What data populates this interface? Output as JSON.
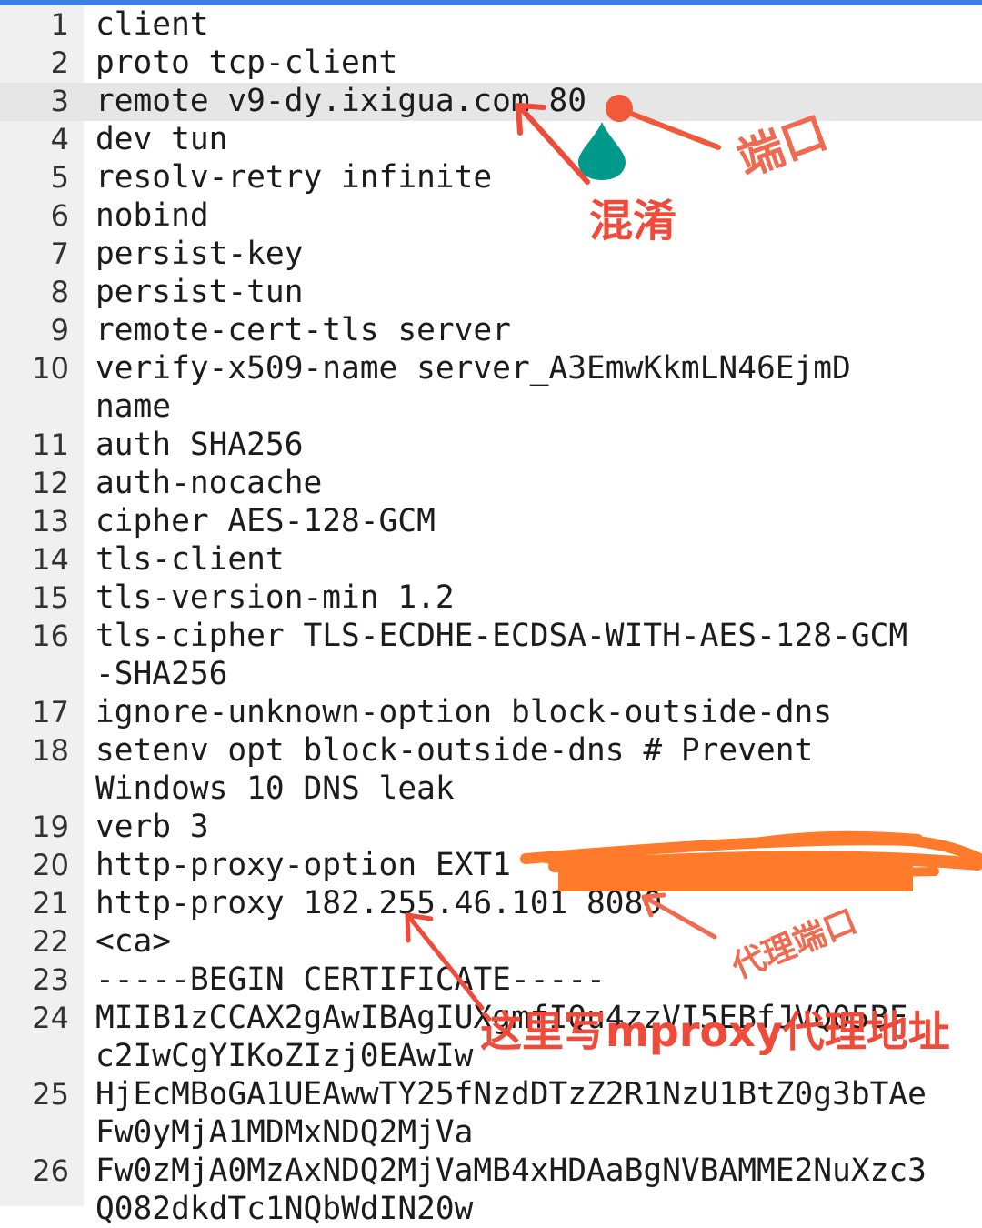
{
  "editor": {
    "highlighted_line": 3,
    "lines": [
      {
        "num": "1",
        "text": "client"
      },
      {
        "num": "2",
        "text": "proto tcp-client"
      },
      {
        "num": "3",
        "text": "remote v9-dy.ixigua.com 80"
      },
      {
        "num": "4",
        "text": "dev tun"
      },
      {
        "num": "5",
        "text": "resolv-retry infinite"
      },
      {
        "num": "6",
        "text": "nobind"
      },
      {
        "num": "7",
        "text": "persist-key"
      },
      {
        "num": "8",
        "text": "persist-tun"
      },
      {
        "num": "9",
        "text": "remote-cert-tls server"
      },
      {
        "num": "10",
        "text": "verify-x509-name server_A3EmwKkmLN46EjmD"
      },
      {
        "num": "",
        "text": "name"
      },
      {
        "num": "11",
        "text": "auth SHA256"
      },
      {
        "num": "12",
        "text": "auth-nocache"
      },
      {
        "num": "13",
        "text": "cipher AES-128-GCM"
      },
      {
        "num": "14",
        "text": "tls-client"
      },
      {
        "num": "15",
        "text": "tls-version-min 1.2"
      },
      {
        "num": "16",
        "text": "tls-cipher TLS-ECDHE-ECDSA-WITH-AES-128-GCM"
      },
      {
        "num": "",
        "text": "-SHA256"
      },
      {
        "num": "17",
        "text": "ignore-unknown-option block-outside-dns"
      },
      {
        "num": "18",
        "text": "setenv opt block-outside-dns # Prevent"
      },
      {
        "num": "",
        "text": "Windows 10 DNS leak"
      },
      {
        "num": "19",
        "text": "verb 3"
      },
      {
        "num": "20",
        "text": "http-proxy-option EXT1"
      },
      {
        "num": "21",
        "text": "http-proxy 182.255.46.101 8080"
      },
      {
        "num": "22",
        "text": "<ca>"
      },
      {
        "num": "23",
        "text": "-----BEGIN CERTIFICATE-----"
      },
      {
        "num": "24",
        "text": "MIIB1zCCAX2gAwIBAgIUXgmfIQu4zzVI5EBfJVQ05BF"
      },
      {
        "num": "",
        "text": "c2IwCgYIKoZIzj0EAwIw"
      },
      {
        "num": "25",
        "text": "HjEcMBoGA1UEAwwTY25fNzdDTzZ2R1NzU1BtZ0g3bTAe"
      },
      {
        "num": "",
        "text": "Fw0yMjA1MDMxNDQ2MjVa"
      },
      {
        "num": "26",
        "text": "Fw0zMjA0MzAxNDQ2MjVaMB4xHDAaBgNVBAMME2NuXzc3"
      },
      {
        "num": "",
        "text": "Q082dkdTc1NQbWdIN20w"
      }
    ]
  },
  "annotations": {
    "obfuscation_label": "混淆",
    "port_label": "端口",
    "proxy_port_label": "代理端口",
    "mproxy_label": "这里写mproxy代理地址",
    "arrow_color": "#f04a3a",
    "scribble_color": "#ff7a2a",
    "drop_color": "#00998a"
  }
}
